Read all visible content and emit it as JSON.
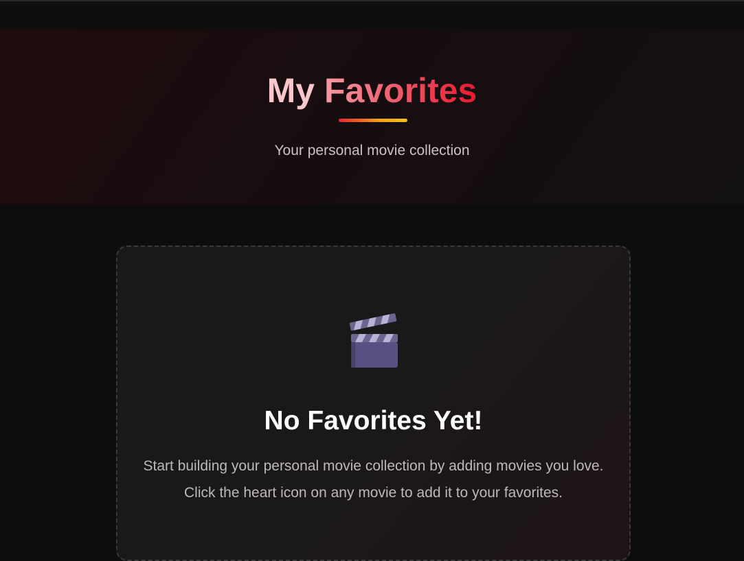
{
  "hero": {
    "title_plain": "My ",
    "title_accent": "Favorites",
    "subtitle": "Your personal movie collection"
  },
  "empty_state": {
    "icon": "clapperboard-icon",
    "title": "No Favorites Yet!",
    "message": "Start building your personal movie collection by adding movies you love. Click the heart icon on any movie to add it to your favorites."
  },
  "colors": {
    "background": "#0d0d0d",
    "hero_background": "#1f0c0e",
    "accent_red": "#e8192f",
    "accent_gold": "#f7c21a",
    "card_background": "#191919"
  }
}
